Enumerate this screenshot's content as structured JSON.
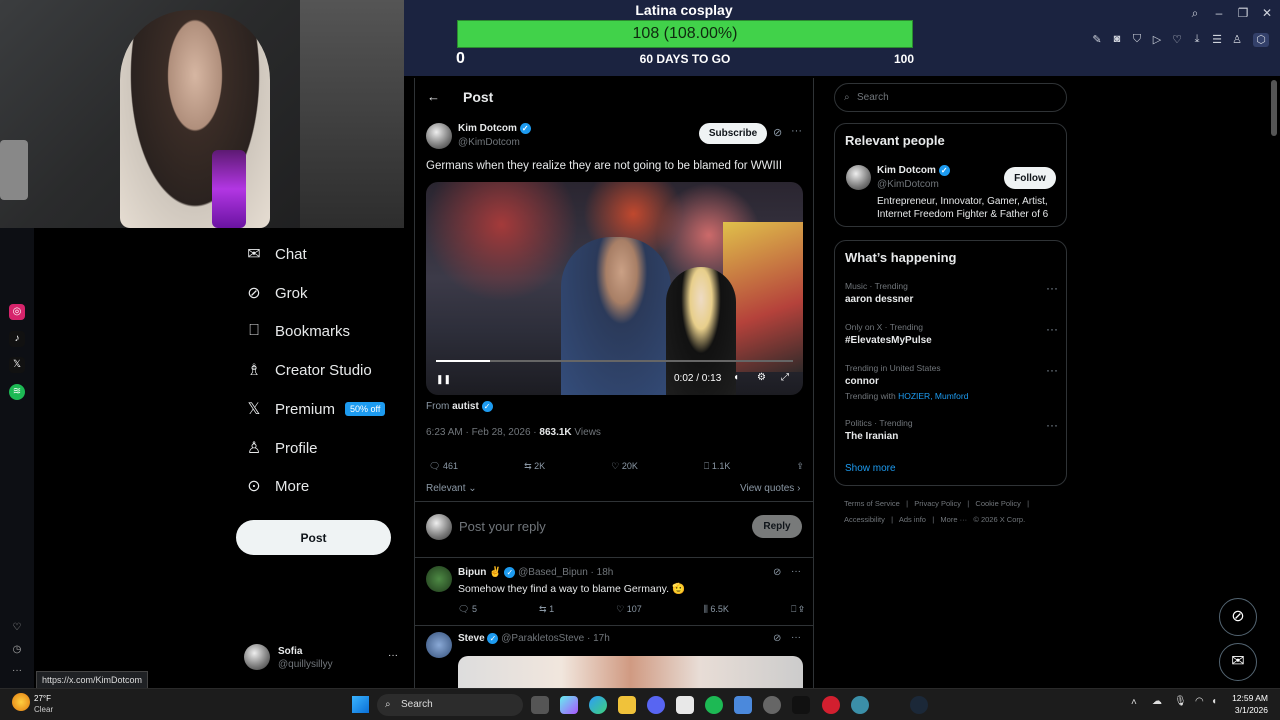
{
  "goal": {
    "title": "Latina cosplay",
    "value": "108 (108.00%)",
    "progress": 1.0,
    "min": "0",
    "max": "100",
    "days": "60 DAYS TO GO"
  },
  "nav": {
    "items": [
      {
        "icon": "chat-icon",
        "label": "Chat"
      },
      {
        "icon": "grok-icon",
        "label": "Grok"
      },
      {
        "icon": "bookmark-icon",
        "label": "Bookmarks"
      },
      {
        "icon": "creator-studio-icon",
        "label": "Creator Studio"
      },
      {
        "icon": "x-logo-icon",
        "label": "Premium"
      },
      {
        "icon": "profile-icon",
        "label": "Profile"
      },
      {
        "icon": "more-icon",
        "label": "More"
      }
    ],
    "premium_badge": "50% off",
    "post_button": "Post"
  },
  "account": {
    "name": "Sofia",
    "handle": "@quillysillyy",
    "more": "···"
  },
  "status_url": "https://x.com/KimDotcom",
  "post": {
    "header": "Post",
    "author": "Kim Dotcom",
    "handle": "@KimDotcom",
    "subscribe": "Subscribe",
    "text": "Germans when they realize they are not going to be blamed for WWIII",
    "video_time": "0:02 / 0:13",
    "from_label": "From",
    "from_user": "autist",
    "timestamp": "6:23 AM · Feb 28, 2026 · ",
    "views": "863.1K",
    "views_label": " Views",
    "replies": "461",
    "reposts": "2K",
    "likes": "20K",
    "bookmarks": "1.1K",
    "relevant": "Relevant",
    "view_quotes": "View quotes",
    "reply_placeholder": "Post your reply",
    "reply_button": "Reply"
  },
  "replies": [
    {
      "name": "Bipun ✌",
      "handle": "@Based_Bipun · 18h",
      "text": "Somehow they find a way to blame Germany. 🫡",
      "replies": "5",
      "reposts": "1",
      "likes": "107",
      "views": "6.5K"
    },
    {
      "name": "Steve",
      "handle": "@ParakletosSteve · 17h"
    }
  ],
  "right": {
    "search_placeholder": "Search",
    "relevant_title": "Relevant people",
    "person": {
      "name": "Kim Dotcom",
      "handle": "@KimDotcom",
      "bio": "Entrepreneur, Innovator, Gamer, Artist, Internet Freedom Fighter & Father of 6",
      "follow": "Follow"
    },
    "happening_title": "What’s happening",
    "trends": [
      {
        "context": "Music · Trending",
        "title": "aaron dessner"
      },
      {
        "context": "Only on X · Trending",
        "title": "#ElevatesMyPulse"
      },
      {
        "context": "Trending in United States",
        "title": "connor",
        "sub_label": "Trending with ",
        "sub_links": "HOZIER, Mumford"
      },
      {
        "context": "Politics · Trending",
        "title": "The Iranian"
      }
    ],
    "show_more": "Show more",
    "footer1": "Terms of Service   |   Privacy Policy   |   Cookie Policy   |",
    "footer2": "Accessibility   |   Ads info   |   More ···   © 2026 X Corp."
  },
  "taskbar": {
    "weather_temp": "27°F",
    "weather_desc": "Clear",
    "search": "Search",
    "time": "12:59 AM",
    "date": "3/1/2026"
  },
  "colors": {
    "accent": "#1d9bf0",
    "goal_green": "#41d24a",
    "topbar": "#1b2340"
  }
}
